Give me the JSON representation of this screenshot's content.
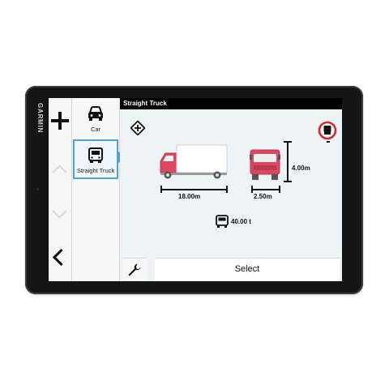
{
  "device": {
    "brand": "GARMIN"
  },
  "header": {
    "title": "Straight Truck"
  },
  "vehicle_list": [
    {
      "label": "Car",
      "icon": "car-icon",
      "selected": false
    },
    {
      "label": "Straight Truck",
      "icon": "truck-icon",
      "selected": true
    }
  ],
  "dimensions": {
    "length": "18.00m",
    "width": "2.50m",
    "height": "4.00m",
    "weight": "40.00 t"
  },
  "actions": {
    "select_label": "Select"
  },
  "colors": {
    "accent": "#4ea3d6",
    "truck_cab": "#d9485f",
    "no_trucks_ring": "#d42a2a"
  }
}
